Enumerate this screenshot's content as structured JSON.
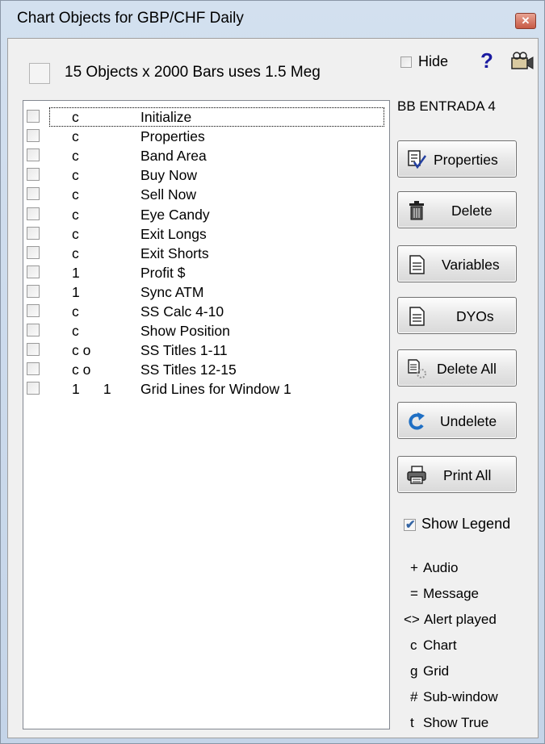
{
  "window": {
    "title": "Chart Objects for GBP/CHF Daily",
    "close_glyph": "✕"
  },
  "summary": {
    "text": "15 Objects x 2000 Bars uses 1.5 Meg"
  },
  "objects": [
    {
      "code": "c",
      "name": "Initialize"
    },
    {
      "code": "c",
      "name": "Properties"
    },
    {
      "code": "c",
      "name": "Band Area"
    },
    {
      "code": "c",
      "name": "Buy Now"
    },
    {
      "code": "c",
      "name": "Sell Now"
    },
    {
      "code": "c",
      "name": "Eye Candy"
    },
    {
      "code": "c",
      "name": "Exit Longs"
    },
    {
      "code": "c",
      "name": "Exit Shorts"
    },
    {
      "code": "1",
      "name": "Profit $"
    },
    {
      "code": "1",
      "name": "Sync ATM"
    },
    {
      "code": "c",
      "name": "SS Calc 4-10"
    },
    {
      "code": "c",
      "name": "Show Position"
    },
    {
      "code": "c o",
      "name": "SS Titles 1-11"
    },
    {
      "code": "c o",
      "name": "SS Titles 12-15"
    },
    {
      "code": "1      1",
      "name": "Grid Lines for Window 1"
    }
  ],
  "side": {
    "hide_label": "Hide",
    "help_glyph": "?",
    "object_name": "BB ENTRADA 4",
    "buttons": {
      "properties": "Properties",
      "delete": "Delete",
      "variables": "Variables",
      "dyos": "DYOs",
      "delete_all": "Delete All",
      "undelete": "Undelete",
      "print_all": "Print All"
    },
    "show_legend_label": "Show Legend",
    "show_legend_checked": "✔",
    "legend": [
      {
        "symbol": "+",
        "label": "Audio"
      },
      {
        "symbol": "=",
        "label": "Message"
      },
      {
        "symbol": "<>",
        "label": "Alert played"
      },
      {
        "symbol": "c",
        "label": "Chart"
      },
      {
        "symbol": "g",
        "label": "Grid"
      },
      {
        "symbol": "#",
        "label": "Sub-window"
      },
      {
        "symbol": "t",
        "label": "Show True"
      }
    ]
  },
  "colors": {
    "accent": "#1a1aa0",
    "close": "#c75a45",
    "undelete_icon": "#1f6fc4"
  }
}
